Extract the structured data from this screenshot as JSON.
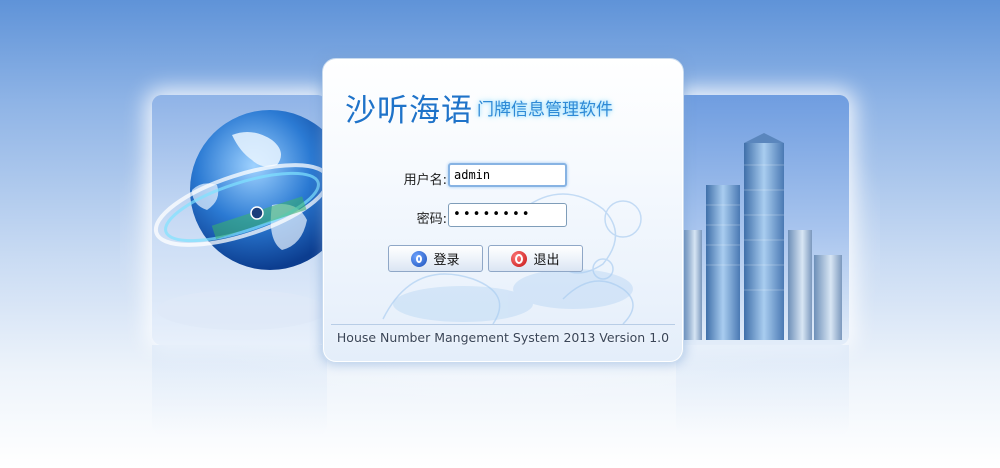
{
  "login": {
    "title_main": "沙听海语",
    "title_sub": "门牌信息管理软件",
    "username_label": "用户名:",
    "username_value": "admin",
    "password_label": "密码:",
    "password_masked": "••••••••",
    "login_button": "登录",
    "exit_button": "退出",
    "footer": "House Number Mangement System 2013 Version 1.0"
  },
  "colors": {
    "title": "#1f73c9",
    "subtitle": "#2f8ad6",
    "login_icon": "#1a4fb8",
    "exit_icon": "#c21010"
  },
  "icons": [
    "globe-illustration",
    "city-skyscrapers-illustration",
    "login-power-icon",
    "exit-power-icon"
  ]
}
